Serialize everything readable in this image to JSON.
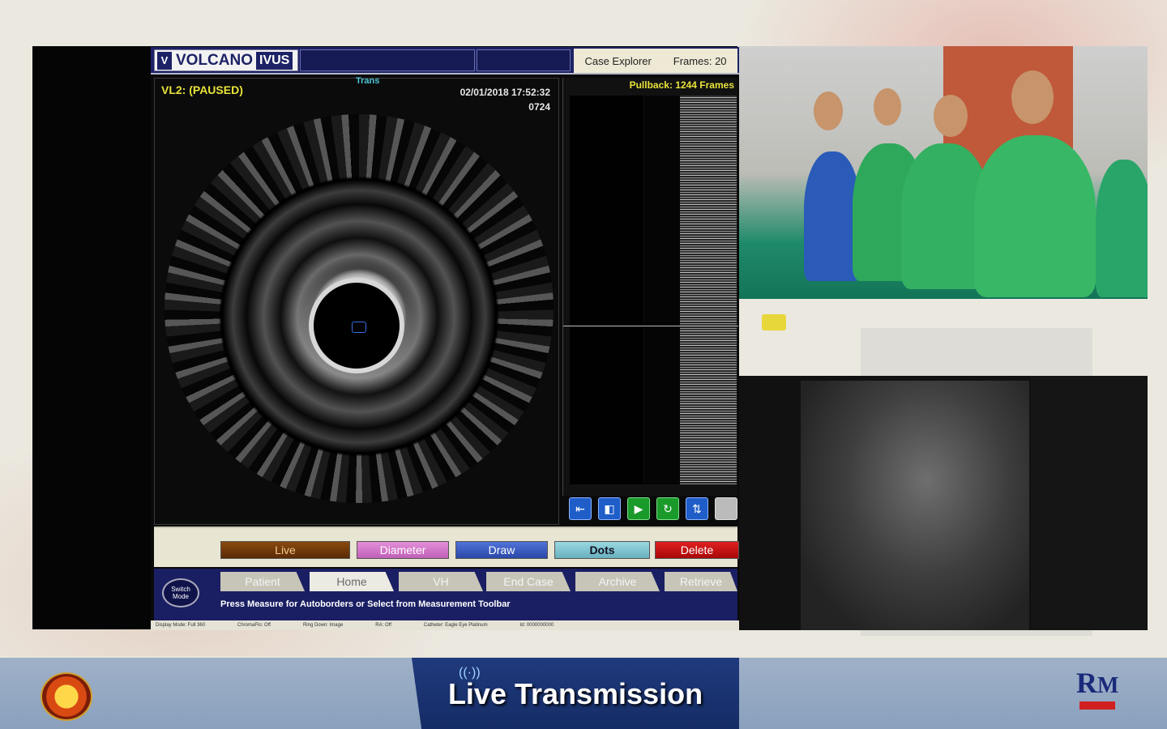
{
  "ivus": {
    "brand": "VOLCANO",
    "product": "IVUS",
    "case_explorer": "Case Explorer",
    "frames": "Frames: 20",
    "mode": "VL2:  (PAUSED)",
    "trans": "Trans",
    "datetime": "02/01/2018 17:52:32",
    "frame_no": "0724",
    "pullback": "Pullback: 1244 Frames",
    "measure_buttons": {
      "live": "Live",
      "diameter": "Diameter",
      "draw": "Draw",
      "dots": "Dots",
      "delete": "Delete"
    },
    "switch_mode": "Switch Mode",
    "tabs": [
      "Patient",
      "Home",
      "VH",
      "End Case",
      "Archive",
      "Retrieve"
    ],
    "active_tab": "Home",
    "hint": "Press Measure for Autoborders or Select from Measurement Toolbar",
    "status": [
      "Display Mode: Full 360",
      "ChromaFlo: Off",
      "Ring Down: Image",
      "RA: Off",
      "Catheter: Eagle Eye Platinum",
      "Id: 0000000000"
    ]
  },
  "footer": {
    "title": "Live Transmission"
  },
  "colors": {
    "ivus_navy": "#1d2266",
    "footer_band": "#1f3a7c",
    "accent_yellow": "#e8e33a"
  }
}
